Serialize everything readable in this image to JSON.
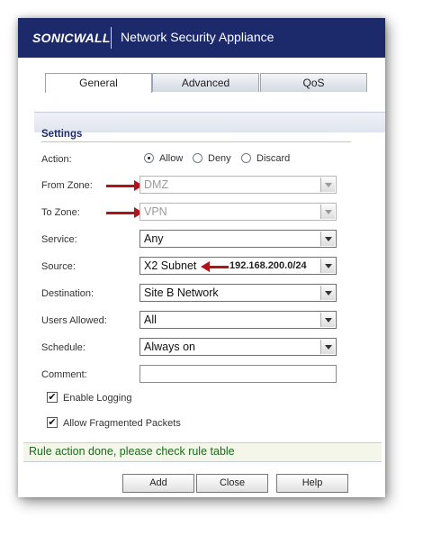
{
  "header": {
    "logo_text": "SONICWALL",
    "title": "Network Security Appliance",
    "background": "#1c2a6c"
  },
  "tabs": [
    {
      "label": "General",
      "active": true
    },
    {
      "label": "Advanced",
      "active": false
    },
    {
      "label": "QoS",
      "active": false
    }
  ],
  "settings": {
    "title": "Settings",
    "action": {
      "label": "Action:",
      "options": [
        {
          "label": "Allow",
          "selected": true
        },
        {
          "label": "Deny",
          "selected": false
        },
        {
          "label": "Discard",
          "selected": false
        }
      ]
    },
    "from_zone": {
      "label": "From Zone:",
      "value": "DMZ",
      "disabled": true
    },
    "to_zone": {
      "label": "To Zone:",
      "value": "VPN",
      "disabled": true
    },
    "service": {
      "label": "Service:",
      "value": "Any"
    },
    "source": {
      "label": "Source:",
      "value": "X2 Subnet",
      "annotation": "192.168.200.0/24"
    },
    "destination": {
      "label": "Destination:",
      "value": "Site B Network"
    },
    "users_allowed": {
      "label": "Users Allowed:",
      "value": "All"
    },
    "schedule": {
      "label": "Schedule:",
      "value": "Always on"
    },
    "comment": {
      "label": "Comment:",
      "value": ""
    },
    "enable_logging": {
      "label": "Enable Logging",
      "checked": true
    },
    "allow_fragmented": {
      "label": "Allow Fragmented Packets",
      "checked": true
    }
  },
  "status": {
    "message": "Rule action done, please check rule table",
    "color": "#1a6b1a"
  },
  "buttons": {
    "add": "Add",
    "close": "Close",
    "help": "Help"
  },
  "annotation_arrow_color": "#b0141a",
  "icons": {
    "checkmark": "✔"
  }
}
